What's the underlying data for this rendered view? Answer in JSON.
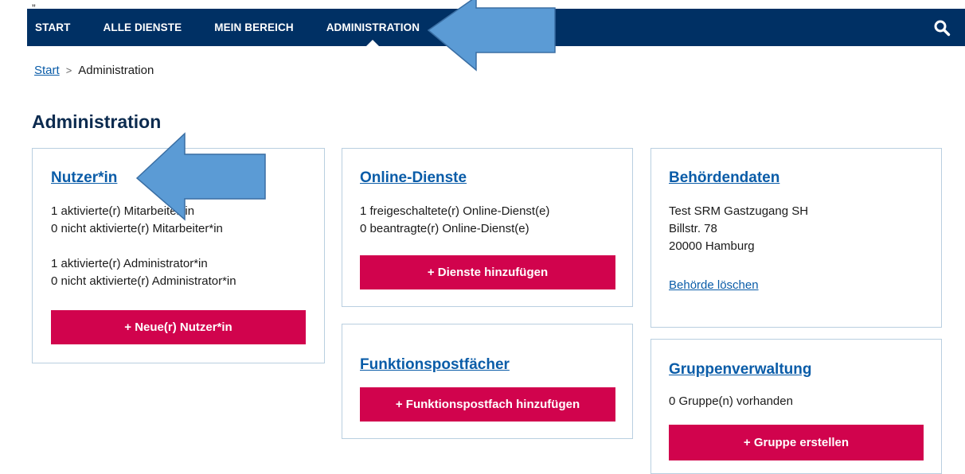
{
  "top_mark": "„",
  "nav": {
    "items": [
      "START",
      "ALLE DIENSTE",
      "MEIN BEREICH",
      "ADMINISTRATION"
    ],
    "active_index": 3
  },
  "breadcrumb": {
    "home": "Start",
    "separator": ">",
    "current": "Administration"
  },
  "page_title": "Administration",
  "cards": {
    "users": {
      "title": "Nutzer*in",
      "lines1": [
        "1 aktivierte(r) Mitarbeiter*in",
        "0 nicht aktivierte(r) Mitarbeiter*in"
      ],
      "lines2": [
        "1 aktivierte(r) Administrator*in",
        "0 nicht aktivierte(r) Administrator*in"
      ],
      "button": "+ Neue(r) Nutzer*in"
    },
    "online_services": {
      "title": "Online-Dienste",
      "lines": [
        "1 freigeschaltete(r) Online-Dienst(e)",
        "0 beantragte(r) Online-Dienst(e)"
      ],
      "button": "+ Dienste hinzufügen"
    },
    "function_mailboxes": {
      "title": "Funktionspostfächer",
      "button": "+ Funktionspostfach hinzufügen"
    },
    "authority": {
      "title": "Behördendaten",
      "lines": [
        "Test SRM Gastzugang SH",
        "Billstr. 78",
        "20000 Hamburg"
      ],
      "delete_link": "Behörde löschen"
    },
    "groups": {
      "title": "Gruppenverwaltung",
      "lines": [
        "0 Gruppe(n) vorhanden"
      ],
      "button": "+ Gruppe erstellen"
    }
  },
  "colors": {
    "nav_bg": "#003064",
    "button_bg": "#d1034d",
    "link": "#0a5ca8",
    "card_border": "#b9cfe0",
    "annotation_arrow": "#5b9bd5"
  },
  "icons": {
    "search": "search-icon",
    "annotation": "arrow-pointer-icon"
  }
}
